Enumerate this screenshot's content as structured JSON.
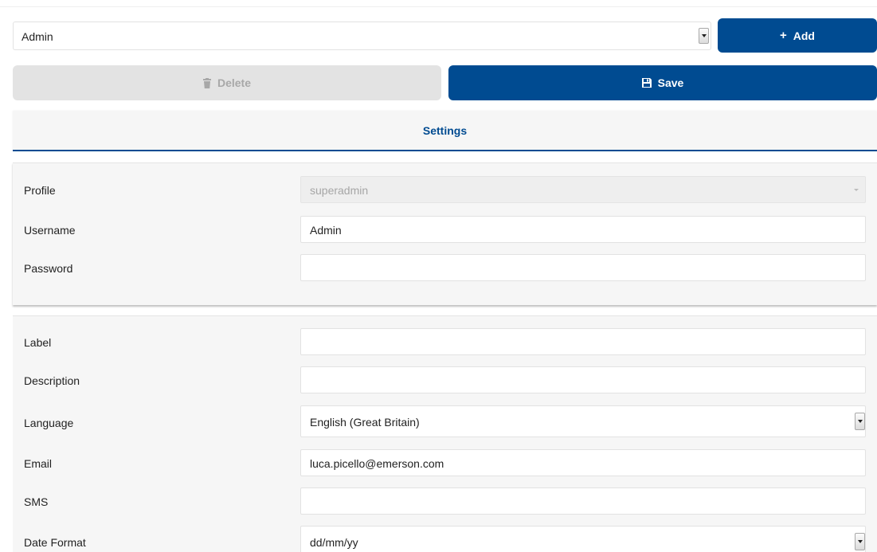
{
  "user_select": {
    "value": "Admin"
  },
  "buttons": {
    "add": "Add",
    "delete": "Delete",
    "save": "Save"
  },
  "tabs": {
    "settings": "Settings"
  },
  "account": {
    "profile": {
      "label": "Profile",
      "value": "superadmin"
    },
    "username": {
      "label": "Username",
      "value": "Admin"
    },
    "password": {
      "label": "Password",
      "value": ""
    }
  },
  "details": {
    "label": {
      "label": "Label",
      "value": ""
    },
    "description": {
      "label": "Description",
      "value": ""
    },
    "language": {
      "label": "Language",
      "value": "English (Great Britain)"
    },
    "email": {
      "label": "Email",
      "value": "luca.picello@emerson.com"
    },
    "sms": {
      "label": "SMS",
      "value": ""
    },
    "date_format": {
      "label": "Date Format",
      "value": "dd/mm/yy"
    }
  },
  "icons": {
    "add": "plus-icon",
    "delete": "trash-icon",
    "save": "floppy-disk-icon"
  },
  "colors": {
    "primary": "#004b91",
    "disabled": "#e3e3e3",
    "panel": "#f6f6f6"
  }
}
